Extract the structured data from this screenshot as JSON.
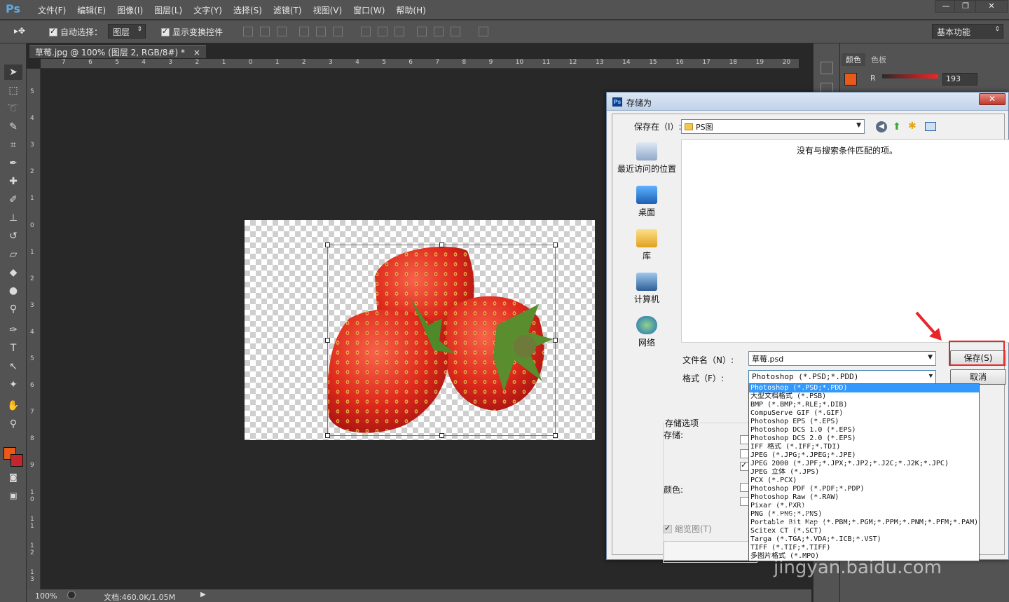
{
  "app": {
    "logo": "Ps",
    "menu": [
      "文件(F)",
      "编辑(E)",
      "图像(I)",
      "图层(L)",
      "文字(Y)",
      "选择(S)",
      "滤镜(T)",
      "视图(V)",
      "窗口(W)",
      "帮助(H)"
    ],
    "window_buttons": [
      "—",
      "❐",
      "✕"
    ]
  },
  "options": {
    "tool_glyph": "▸✥",
    "auto_select_label": "自动选择：",
    "auto_select_target": "图层",
    "show_transform_label": "显示变换控件",
    "workspace": "基本功能"
  },
  "document": {
    "tab_title": "草莓.jpg @ 100% (图层 2, RGB/8#) *",
    "tab_close": "×",
    "ruler_top": [
      "7",
      "6",
      "5",
      "4",
      "3",
      "2",
      "1",
      "0",
      "1",
      "2",
      "3",
      "4",
      "5",
      "6",
      "7",
      "8",
      "9",
      "10",
      "11",
      "12",
      "13",
      "14",
      "15",
      "16",
      "17",
      "18",
      "19",
      "20"
    ],
    "ruler_left": [
      "5",
      "4",
      "3",
      "2",
      "1",
      "0",
      "1",
      "2",
      "3",
      "4",
      "5",
      "6",
      "7",
      "8",
      "9",
      "1 0",
      "1 1",
      "1 2",
      "1 3"
    ]
  },
  "status": {
    "zoom": "100%",
    "doc_info": "文档:460.0K/1.05M"
  },
  "panels": {
    "tab_color": "颜色",
    "tab_swatches": "色板",
    "r_label": "R",
    "r_value": "193",
    "foreground_color": "#e8591a",
    "background_color": "#c1272d"
  },
  "dialog": {
    "title": "存储为",
    "close": "✕",
    "save_in_label": "保存在（I）:",
    "save_in_value": "PS图",
    "empty_message": "没有与搜索条件匹配的项。",
    "places": [
      "最近访问的位置",
      "桌面",
      "库",
      "计算机",
      "网络"
    ],
    "filename_label": "文件名（N）:",
    "filename_value": "草莓.psd",
    "format_label": "格式（F）:",
    "format_value": "Photoshop (*.PSD;*.PDD)",
    "save_button": "保存(S)",
    "cancel_button": "取消",
    "save_options_label": "存储选项",
    "save_label": "存储:",
    "color_label": "颜色:",
    "thumbnail_label": "缩览图(T)"
  },
  "format_options": [
    "Photoshop (*.PSD;*.PDD)",
    "大型文档格式 (*.PSB)",
    "BMP (*.BMP;*.RLE;*.DIB)",
    "CompuServe GIF (*.GIF)",
    "Photoshop EPS (*.EPS)",
    "Photoshop DCS 1.0 (*.EPS)",
    "Photoshop DCS 2.0 (*.EPS)",
    "IFF 格式 (*.IFF;*.TDI)",
    "JPEG (*.JPG;*.JPEG;*.JPE)",
    "JPEG 2000 (*.JPF;*.JPX;*.JP2;*.J2C;*.J2K;*.JPC)",
    "JPEG 立体 (*.JPS)",
    "PCX (*.PCX)",
    "Photoshop PDF (*.PDF;*.PDP)",
    "Photoshop Raw (*.RAW)",
    "Pixar (*.PXR)",
    "PNG (*.PNG;*.PNS)",
    "Portable Bit Map (*.PBM;*.PGM;*.PPM;*.PNM;*.PFM;*.PAM)",
    "Scitex CT (*.SCT)",
    "Targa (*.TGA;*.VDA;*.ICB;*.VST)",
    "TIFF (*.TIF;*.TIFF)",
    "多图片格式 (*.MPO)"
  ],
  "watermark": {
    "text": "经验",
    "url": "jingyan.baidu.com"
  }
}
